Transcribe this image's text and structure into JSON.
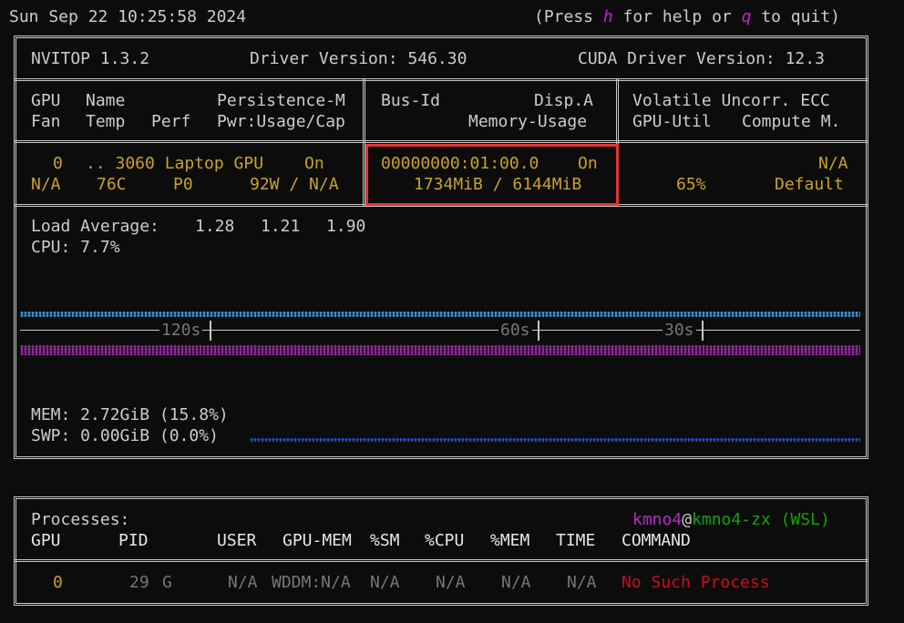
{
  "top_bar": {
    "datetime": "Sun Sep 22 10:25:58 2024",
    "help_pre": "(Press ",
    "help_key": "h",
    "help_mid": " for help or ",
    "quit_key": "q",
    "help_post": " to quit)"
  },
  "header": {
    "nvitop": "NVITOP 1.3.2",
    "driver": "Driver Version: 546.30",
    "cuda": "CUDA Driver Version: 12.3"
  },
  "cols": {
    "gpu": "GPU",
    "name": "Name",
    "persistence": "Persistence-M",
    "fan": "Fan",
    "temp": "Temp",
    "perf": "Perf",
    "pwr": "Pwr:Usage/Cap",
    "busid": "Bus-Id",
    "disp": "Disp.A",
    "memusage": "Memory-Usage",
    "volatile": "Volatile Uncorr. ECC",
    "gpuutil": "GPU-Util",
    "compute": "Compute M."
  },
  "gpu0": {
    "index": "0",
    "name": ".. 3060 Laptop GPU",
    "persistence": "On",
    "fan": "N/A",
    "temp": "76C",
    "perf": "P0",
    "power": "92W / N/A",
    "bus_id": "00000000:01:00.0",
    "disp": "On",
    "memory": "1734MiB / 6144MiB",
    "ecc": "N/A",
    "util": "65%",
    "compute": "Default"
  },
  "host": {
    "load_label": "Load Average:",
    "load1": "1.28",
    "load5": "1.21",
    "load15": "1.90",
    "cpu": "CPU: 7.7%",
    "mem": "MEM: 2.72GiB (15.8%)",
    "swp": "SWP: 0.00GiB (0.0%)",
    "axis_120": "120s",
    "axis_60": "60s",
    "axis_30": "30s"
  },
  "processes": {
    "title": "Processes:",
    "user": "kmno4",
    "at": "@",
    "host": "kmno4-zx",
    "env": " (WSL)",
    "headers": {
      "gpu": "GPU",
      "pid": "PID",
      "user": "USER",
      "gpumem": "GPU-MEM",
      "sm": "%SM",
      "cpu": "%CPU",
      "mem": "%MEM",
      "time": "TIME",
      "command": "COMMAND"
    },
    "rows": [
      {
        "gpu": "0",
        "pid": "29",
        "type": "G",
        "user": "N/A",
        "gpumem": "WDDM:N/A",
        "sm": "N/A",
        "cpu": "N/A",
        "mem": "N/A",
        "time": "N/A",
        "command": "No Such Process"
      }
    ]
  },
  "colors": {
    "gpu_line": "#3a96dd",
    "cpu_line": "#9b2aa8",
    "swp_line": "#1f4fd8",
    "highlight": "#e23535",
    "accent_yellow": "#c9a227"
  }
}
